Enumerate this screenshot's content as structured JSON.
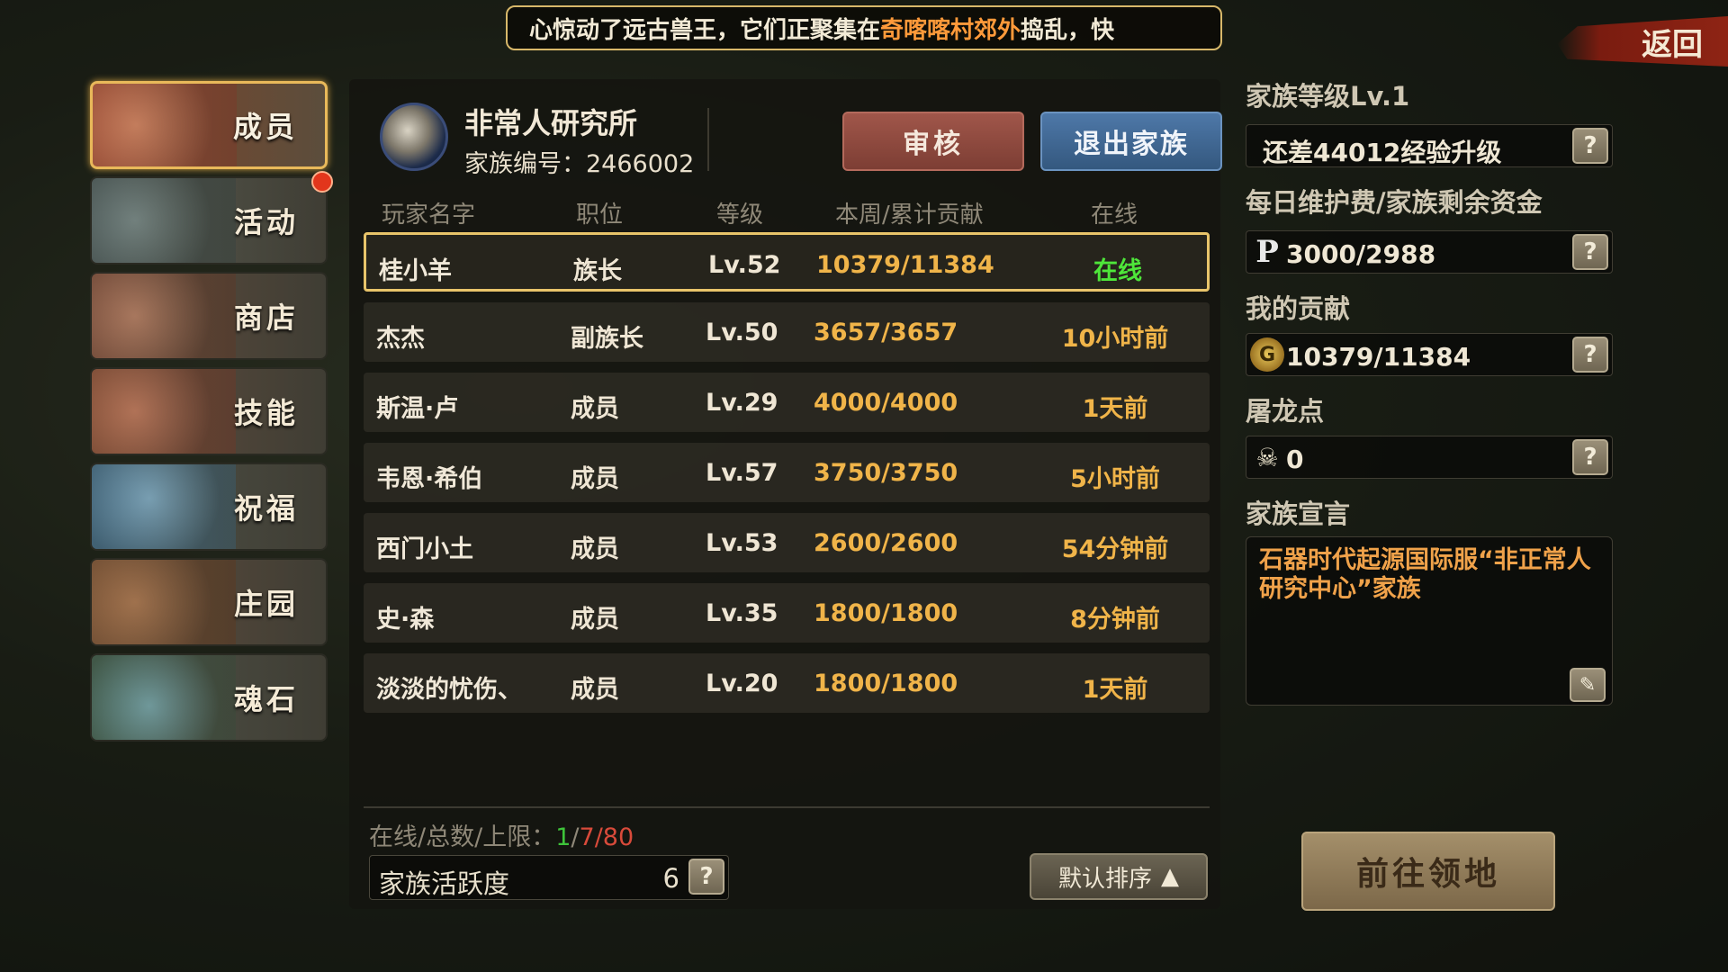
{
  "marquee": {
    "prefix": "心惊动了远古兽王，它们正聚集在",
    "highlight": "奇喀喀村郊外",
    "suffix": "捣乱，快"
  },
  "back_label": "返回",
  "sidebar": {
    "items": [
      {
        "label": "成员",
        "active": true
      },
      {
        "label": "活动",
        "active": false
      },
      {
        "label": "商店",
        "active": false
      },
      {
        "label": "技能",
        "active": false
      },
      {
        "label": "祝福",
        "active": false
      },
      {
        "label": "庄园",
        "active": false
      },
      {
        "label": "魂石",
        "active": false
      }
    ]
  },
  "family": {
    "name": "非常人研究所",
    "id_label": "家族编号：",
    "id_value": "2466002",
    "review_label": "审核",
    "quit_label": "退出家族"
  },
  "table": {
    "headers": [
      "玩家名字",
      "职位",
      "等级",
      "本周/累计贡献",
      "在线"
    ],
    "rows": [
      {
        "name": "桂小羊",
        "position": "族长",
        "level": "Lv.52",
        "contribution": "10379/11384",
        "online": "在线"
      },
      {
        "name": "杰杰",
        "position": "副族长",
        "level": "Lv.50",
        "contribution": "3657/3657",
        "online": "10小时前"
      },
      {
        "name": "斯温·卢",
        "position": "成员",
        "level": "Lv.29",
        "contribution": "4000/4000",
        "online": "1天前"
      },
      {
        "name": "韦恩·希伯",
        "position": "成员",
        "level": "Lv.57",
        "contribution": "3750/3750",
        "online": "5小时前"
      },
      {
        "name": "西门小土",
        "position": "成员",
        "level": "Lv.53",
        "contribution": "2600/2600",
        "online": "54分钟前"
      },
      {
        "name": "史·森",
        "position": "成员",
        "level": "Lv.35",
        "contribution": "1800/1800",
        "online": "8分钟前"
      },
      {
        "name": "淡淡的忧伤、",
        "position": "成员",
        "level": "Lv.20",
        "contribution": "1800/1800",
        "online": "1天前"
      }
    ]
  },
  "footer": {
    "stats_label": "在线/总数/上限：",
    "online": "1",
    "total": "7",
    "limit": "80",
    "activity_label": "家族活跃度",
    "activity_value": "6",
    "sort_label": "默认排序"
  },
  "right": {
    "level_label": "家族等级Lv.1",
    "level_box": "还差44012经验升级",
    "upkeep_label": "每日维护费/家族剩余资金",
    "upkeep_value": "3000/2988",
    "contrib_label": "我的贡献",
    "contrib_value": "10379/11384",
    "dragon_label": "屠龙点",
    "dragon_value": "0",
    "manifesto_label": "家族宣言",
    "manifesto_text": "石器时代起源国际服“非正常人研究中心”家族",
    "goto_label": "前往领地"
  },
  "icons": {
    "question": "?",
    "p_currency": "P",
    "g_currency": "G",
    "skull": "☠",
    "pencil": "✎",
    "triangle_up": "▲"
  },
  "colors": {
    "accent_gold": "#e8c46a",
    "online_green": "#4ee63a",
    "contribution_orange": "#f0b449",
    "limit_red": "#d84a3a",
    "highlight_orange": "#ff9a3a"
  }
}
